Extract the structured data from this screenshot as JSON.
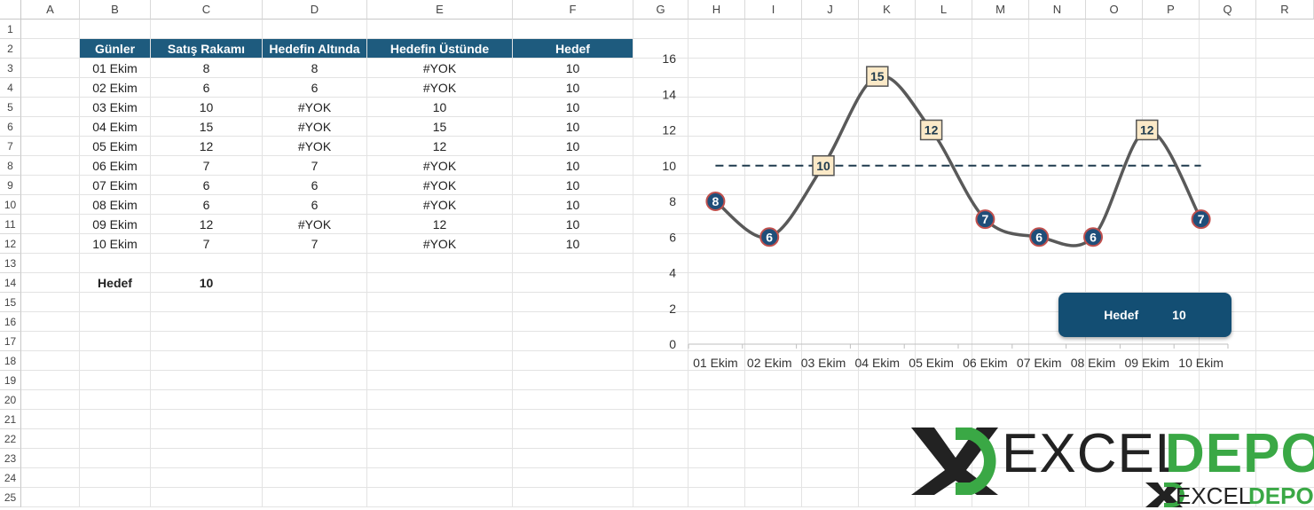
{
  "columns": [
    "A",
    "B",
    "C",
    "D",
    "E",
    "F",
    "G",
    "H",
    "I",
    "J",
    "K",
    "L",
    "M",
    "N",
    "O",
    "P",
    "Q",
    "R"
  ],
  "rows": [
    "1",
    "2",
    "3",
    "4",
    "5",
    "6",
    "7",
    "8",
    "9",
    "10",
    "11",
    "12",
    "13",
    "14",
    "15",
    "16",
    "17",
    "18",
    "19",
    "20",
    "21",
    "22",
    "23",
    "24",
    "25"
  ],
  "table": {
    "headers": [
      "Günler",
      "Satış Rakamı",
      "Hedefin Altında",
      "Hedefin Üstünde",
      "Hedef"
    ],
    "rows": [
      [
        "01 Ekim",
        "8",
        "8",
        "#YOK",
        "10"
      ],
      [
        "02 Ekim",
        "6",
        "6",
        "#YOK",
        "10"
      ],
      [
        "03 Ekim",
        "10",
        "#YOK",
        "10",
        "10"
      ],
      [
        "04 Ekim",
        "15",
        "#YOK",
        "15",
        "10"
      ],
      [
        "05 Ekim",
        "12",
        "#YOK",
        "12",
        "10"
      ],
      [
        "06 Ekim",
        "7",
        "7",
        "#YOK",
        "10"
      ],
      [
        "07 Ekim",
        "6",
        "6",
        "#YOK",
        "10"
      ],
      [
        "08 Ekim",
        "6",
        "6",
        "#YOK",
        "10"
      ],
      [
        "09 Ekim",
        "12",
        "#YOK",
        "12",
        "10"
      ],
      [
        "10 Ekim",
        "7",
        "7",
        "#YOK",
        "10"
      ]
    ]
  },
  "target": {
    "label": "Hedef",
    "value": "10"
  },
  "hedef_box": {
    "label": "Hedef",
    "value": "10"
  },
  "logo": {
    "big_left": "EXCEL",
    "big_right": "DEPO",
    "small_left": "EXCEL",
    "small_right": "DEPO"
  },
  "chart_data": {
    "type": "line",
    "categories": [
      "01 Ekim",
      "02 Ekim",
      "03 Ekim",
      "04 Ekim",
      "05 Ekim",
      "06 Ekim",
      "07 Ekim",
      "08 Ekim",
      "09 Ekim",
      "10 Ekim"
    ],
    "series": [
      {
        "values": [
          8,
          6,
          10,
          15,
          12,
          7,
          6,
          6,
          12,
          7
        ]
      },
      {
        "values": [
          8,
          6,
          null,
          null,
          null,
          7,
          6,
          6,
          null,
          7
        ]
      },
      {
        "values": [
          null,
          null,
          10,
          15,
          12,
          null,
          null,
          null,
          12,
          null
        ]
      },
      {
        "values": [
          10,
          10,
          10,
          10,
          10,
          10,
          10,
          10,
          10,
          10
        ]
      }
    ],
    "ylim": [
      0,
      16
    ],
    "yticks": [
      0,
      2,
      4,
      6,
      8,
      10,
      12,
      14,
      16
    ],
    "colors": {
      "line": "#595959",
      "below_marker": "#1f4e79",
      "below_marker_border": "#c0504d",
      "above_marker_fill": "#fbe9c7",
      "above_marker_border": "#555555",
      "target_line": "#1f3a4d"
    }
  }
}
